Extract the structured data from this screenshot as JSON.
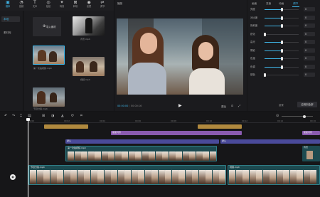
{
  "top_tabs": [
    {
      "label": "媒体",
      "icon": "media-icon",
      "active": true
    },
    {
      "label": "音频",
      "icon": "audio-icon"
    },
    {
      "label": "文本",
      "icon": "text-icon"
    },
    {
      "label": "贴纸",
      "icon": "sticker-icon"
    },
    {
      "label": "特效",
      "icon": "effects-icon"
    },
    {
      "label": "转场",
      "icon": "transition-icon"
    },
    {
      "label": "滤镜",
      "icon": "filter-icon"
    },
    {
      "label": "调节",
      "icon": "adjust-icon"
    }
  ],
  "left_nav": {
    "items": [
      {
        "label": "本地",
        "active": true
      },
      {
        "label": "素材库",
        "active": false
      }
    ]
  },
  "media": {
    "import_label": "导入素材",
    "items": [
      {
        "name": "背景.mp4"
      },
      {
        "name": "第一次拍视频.mp4"
      },
      {
        "name": "视频.mp4"
      },
      {
        "name": "节目分镜.mp4"
      }
    ]
  },
  "preview": {
    "title": "播放",
    "time_current": "00:00:00",
    "time_total": "00:00:16",
    "ratio_label": "原始",
    "colors": {
      "accent": "#3fb6e8"
    }
  },
  "settings": {
    "tabs": [
      "画面",
      "变速",
      "动画",
      "调节"
    ],
    "active_tab": 3,
    "rows": [
      {
        "label": "亮度",
        "value": "0",
        "level": 0.5
      },
      {
        "label": "对比度",
        "value": "0",
        "level": 0.5
      },
      {
        "label": "饱和度",
        "value": "0",
        "level": 0.5
      },
      {
        "label": "锐化",
        "value": "0",
        "level": 0.0
      },
      {
        "label": "高光",
        "value": "0",
        "level": 0.5
      },
      {
        "label": "阴影",
        "value": "0",
        "level": 0.5
      },
      {
        "label": "色温",
        "value": "0",
        "level": 0.5
      },
      {
        "label": "色调",
        "value": "0",
        "level": 0.5
      },
      {
        "label": "褪色",
        "value": "0",
        "level": 0.0
      }
    ],
    "reset_label": "重置",
    "apply_all_label": "应用到全部"
  },
  "timeline": {
    "tools": [
      "undo",
      "redo",
      "split",
      "delete",
      "freeze",
      "reverse",
      "mirror",
      "rotate",
      "crop"
    ],
    "ruler_ticks": [
      "00:00",
      "00:02",
      "00:04",
      "00:06",
      "00:08",
      "00:10",
      "00:12",
      "00:14",
      "00:16"
    ],
    "tracks": {
      "audio": [
        {
          "label": ""
        },
        {
          "label": ""
        }
      ],
      "effects": [
        {
          "label": "星星闪烁"
        },
        {
          "label": "星星闪烁"
        }
      ],
      "text": [
        {
          "label": "默认"
        },
        {
          "label": "默认"
        }
      ],
      "video_top": {
        "label": "第一次拍视频.mp4"
      },
      "video_main": [
        {
          "label": "节目分镜.mp4"
        },
        {
          "label": "视频.mp4"
        }
      ],
      "side_label": "背景"
    }
  }
}
